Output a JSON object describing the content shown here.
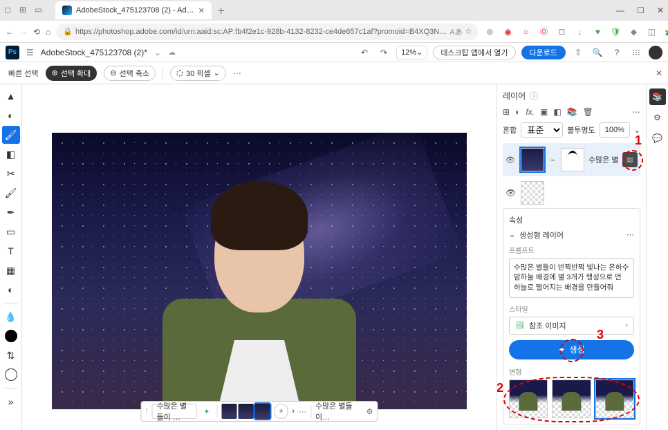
{
  "browser": {
    "tab_title": "AdobeStock_475123708 (2) - Ad…",
    "url": "https://photoshop.adobe.com/id/urn:aaid:sc:AP:fb4f2e1c-928b-4132-8232-ce4de657c1af?promoid=B4XQ3NP…"
  },
  "app": {
    "doc_name": "AdobeStock_475123708 (2)*",
    "zoom": "12%",
    "desktop_open": "데스크탑 앱에서 열기",
    "download": "다운로드"
  },
  "options": {
    "quick_select": "빠른 선택",
    "expand": "선택 확대",
    "shrink": "선택 축소",
    "brush_size": "30 픽셀"
  },
  "context": {
    "input_text": "수많은 별들이 …",
    "label": "수많은 별들이…"
  },
  "layers": {
    "title": "레이어",
    "blend_label": "혼합",
    "blend_mode": "표준",
    "opacity_label": "불투명도",
    "opacity": "100%",
    "layer1_name": "수많은 별들"
  },
  "props": {
    "title": "속성",
    "section": "생성형 레이어",
    "prompt_label": "프롬프트",
    "prompt_text": "수많은 별들이 반짝반짝 빛나는 은하수 밤하늘 배경에 별 3개가 행성으로 먼 하늘로 떨어지는 배경을 만들어줘",
    "style_label": "스타일",
    "ref_image": "참조 이미지",
    "generate": "생성",
    "variations_label": "변형"
  },
  "annotations": {
    "a1": "1",
    "a2": "2",
    "a3": "3"
  }
}
